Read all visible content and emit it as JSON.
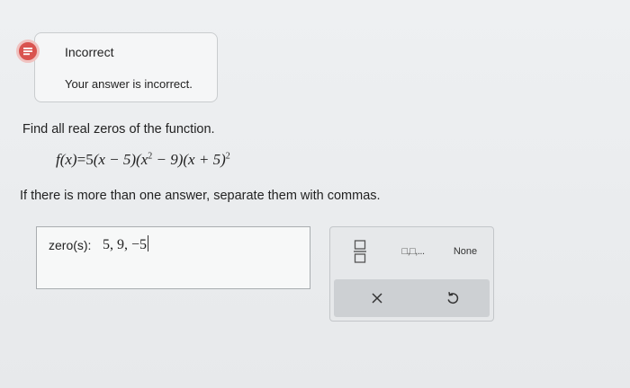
{
  "feedback": {
    "status_icon": "incorrect-icon",
    "title": "Incorrect",
    "message": "Your answer is incorrect.",
    "accent_color": "#d9534f"
  },
  "question": {
    "prompt": "Find all real zeros of the function.",
    "equation": {
      "lhs": "f(x)",
      "eq": "=",
      "coef": "5",
      "factor1": "(x − 5)",
      "factor2_open": "(x",
      "factor2_exp": "2",
      "factor2_close": " − 9)",
      "factor3": "(x + 5)",
      "factor3_exp": "2"
    },
    "instruction": "If there is more than one answer, separate them with commas."
  },
  "answer": {
    "label": "zero(s):",
    "value": "5, 9, −5"
  },
  "keypad": {
    "fraction_icon": "fraction-icon",
    "list_label": "□,□,...",
    "none_label": "None",
    "clear_icon": "close-icon",
    "undo_icon": "undo-icon"
  }
}
